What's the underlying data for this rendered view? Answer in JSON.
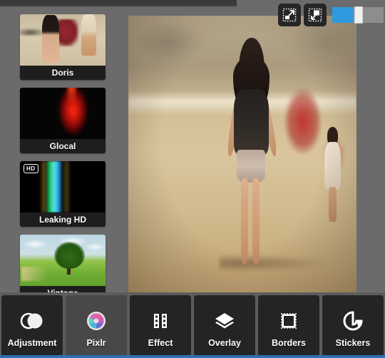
{
  "app": {
    "background_color": "#6b6b6b",
    "accent_color": "#2d9ae0",
    "bottom_strip_color": "#2d6fb5"
  },
  "top_controls": {
    "buttons": [
      {
        "name": "expand-to-fit-button",
        "icon": "expand-arrow-icon",
        "tooltip": "Expand"
      },
      {
        "name": "shrink-to-fit-button",
        "icon": "shrink-arrow-icon",
        "tooltip": "Fit"
      }
    ],
    "slider": {
      "name": "opacity-slider",
      "value": 40,
      "min": 0,
      "max": 100,
      "fill_color": "#2d9ae0"
    }
  },
  "filter_panel": {
    "items": [
      {
        "label": "Doris",
        "badge": "",
        "selected": false
      },
      {
        "label": "Glocal",
        "badge": "",
        "selected": false
      },
      {
        "label": "Leaking HD",
        "badge": "HD",
        "selected": false
      },
      {
        "label": "Vintage",
        "badge": "",
        "selected": false
      }
    ]
  },
  "canvas": {
    "name": "photo-canvas",
    "description": "Edited beach photo preview"
  },
  "bottom_tabs": [
    {
      "label": "Adjustment",
      "icon": "contrast-circles-icon",
      "state": "active"
    },
    {
      "label": "Pixlr",
      "icon": "pixlr-aperture-icon",
      "state": "light"
    },
    {
      "label": "Effect",
      "icon": "film-strip-icon",
      "state": "normal"
    },
    {
      "label": "Overlay",
      "icon": "layers-icon",
      "state": "normal"
    },
    {
      "label": "Borders",
      "icon": "stamp-frame-icon",
      "state": "normal"
    },
    {
      "label": "Stickers",
      "icon": "sticker-peel-icon",
      "state": "normal"
    }
  ]
}
